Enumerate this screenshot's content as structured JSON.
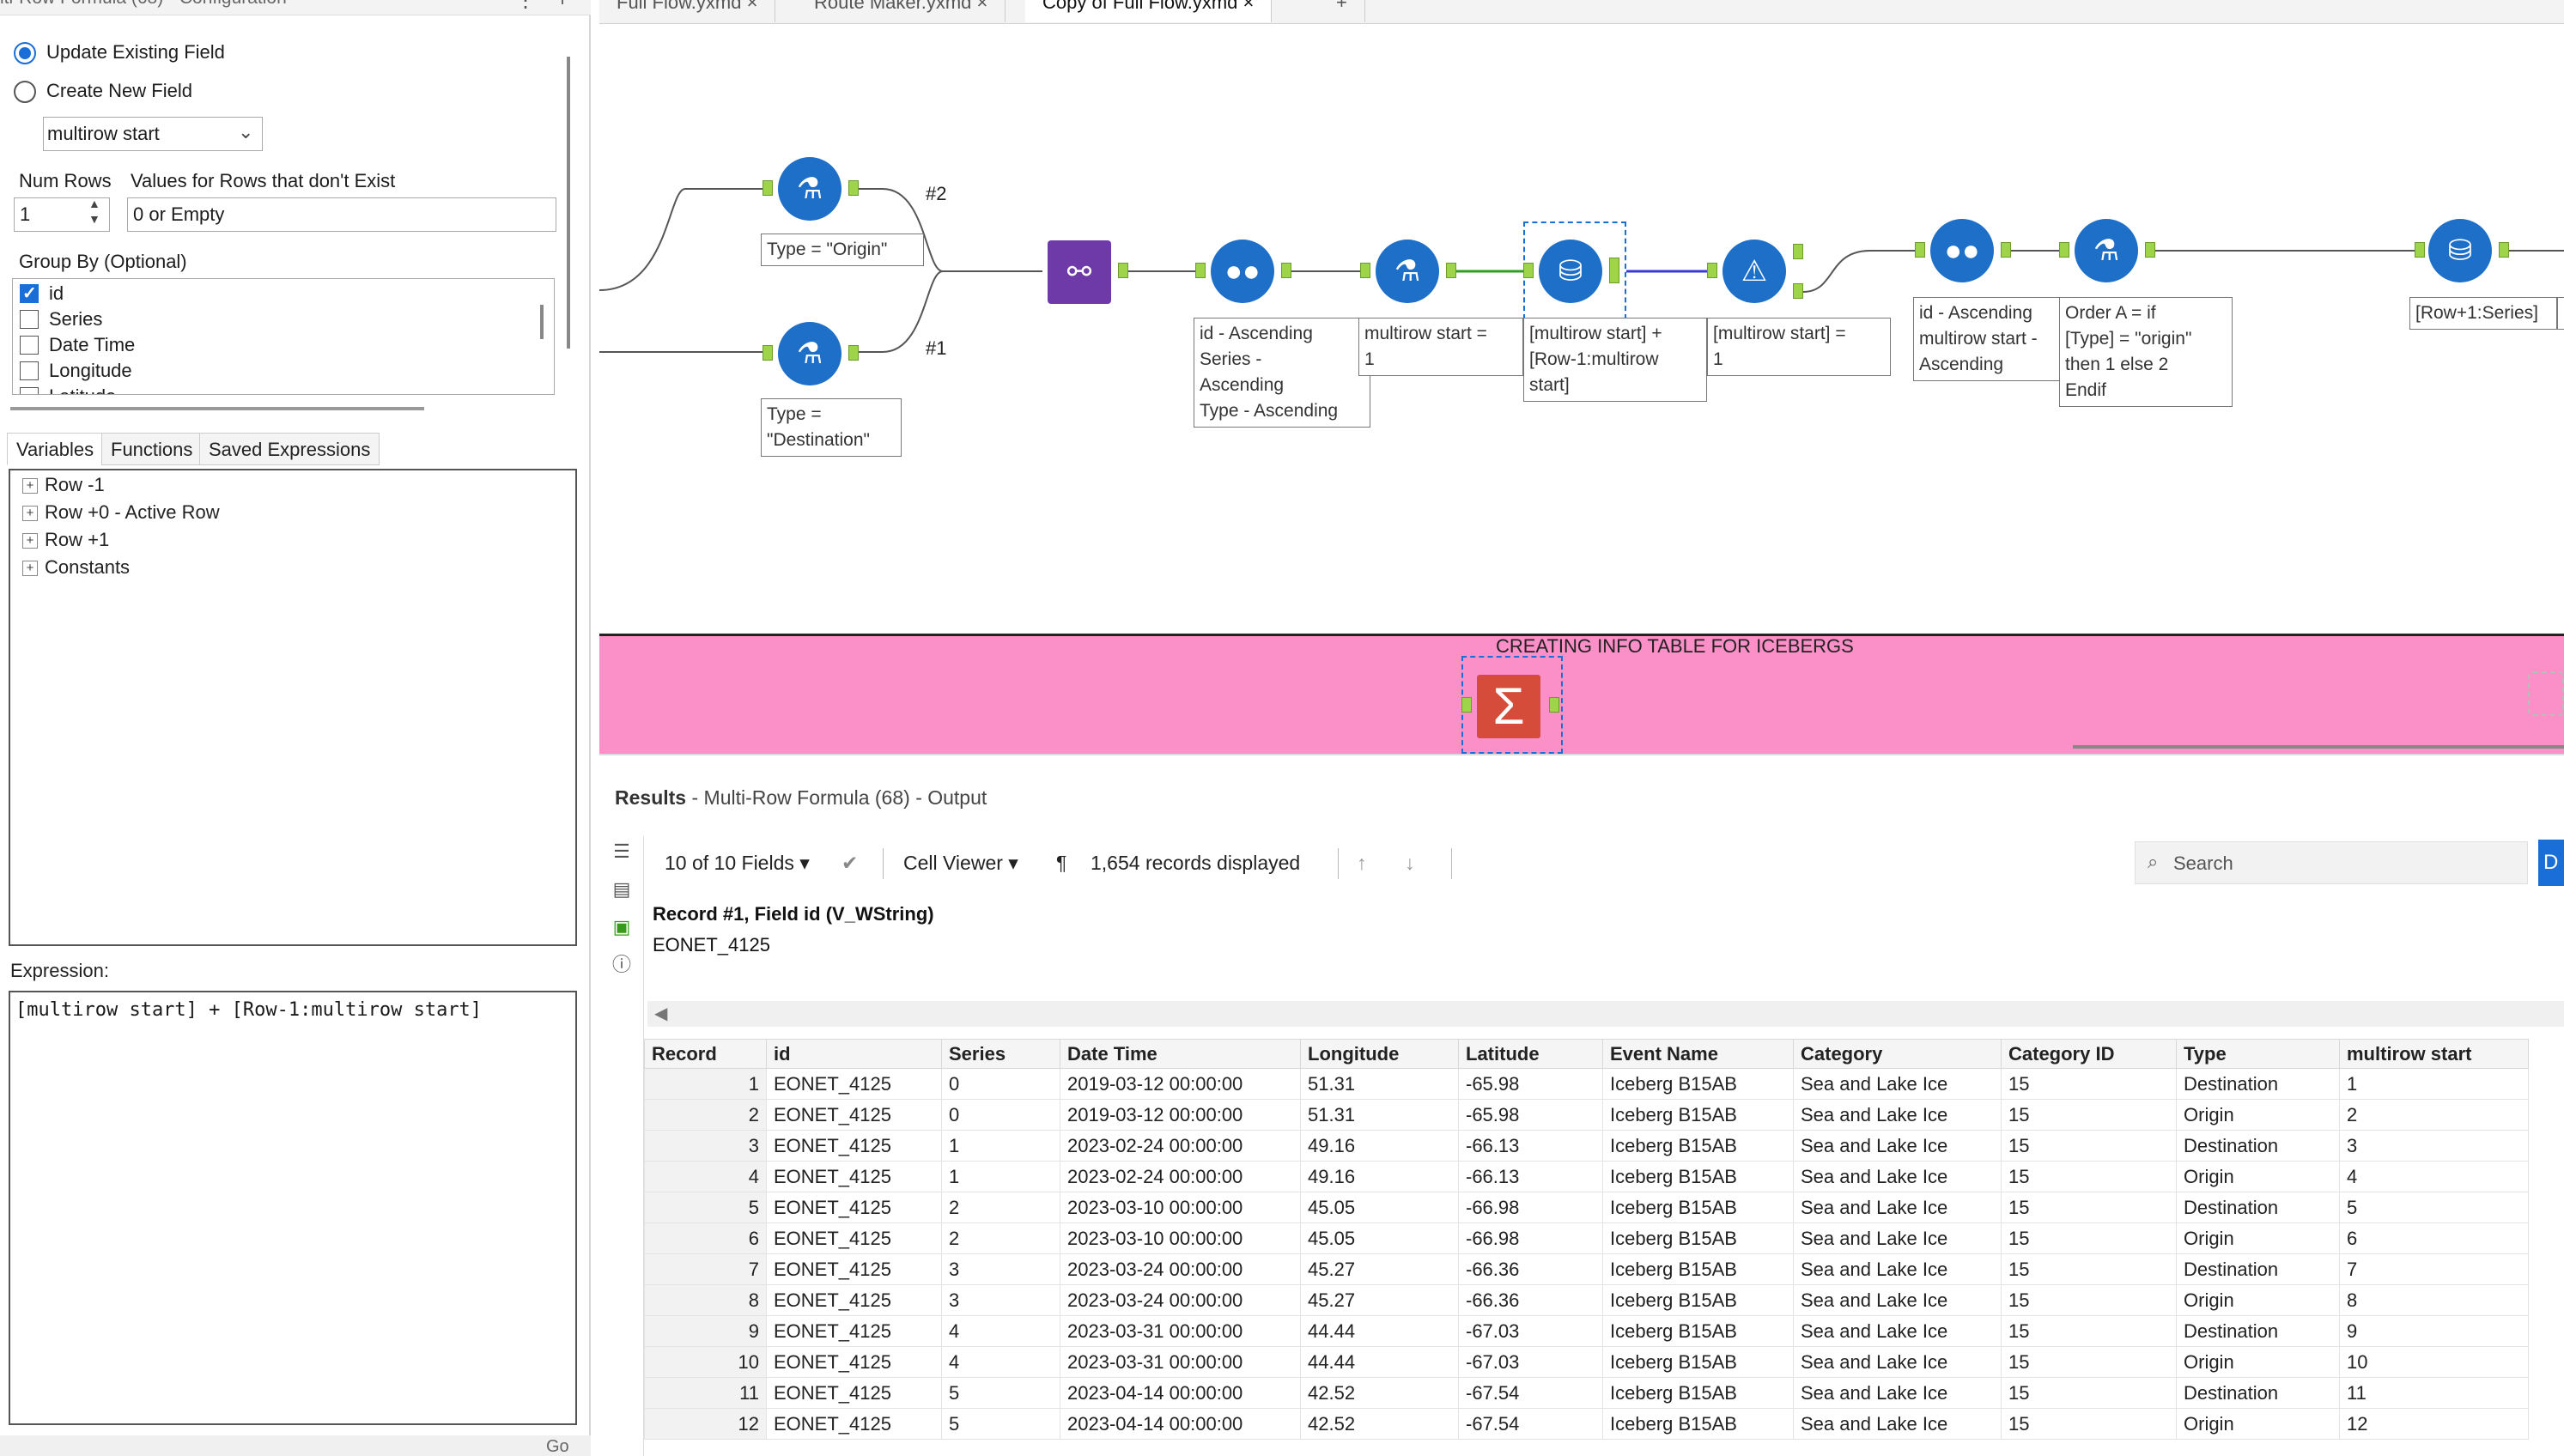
{
  "config": {
    "title": "lti-Row Formula (68) - Configuration",
    "update_existing": "Update Existing Field",
    "create_new": "Create New  Field",
    "field_select": "multirow start",
    "num_rows_label": "Num Rows",
    "num_rows_value": "1",
    "values_label": "Values for Rows that don't Exist",
    "values_value": "0 or Empty",
    "group_by_label": "Group By (Optional)",
    "group_fields": [
      "id",
      "Series",
      "Date Time",
      "Longitude",
      "Latitude"
    ],
    "tabs": [
      "Variables",
      "Functions",
      "Saved Expressions"
    ],
    "tree": [
      "Row -1",
      "Row +0 - Active Row",
      "Row +1",
      "Constants"
    ],
    "expression_label": "Expression:",
    "expression": "[multirow start] + [Row-1:multirow start]",
    "go_label": "Go"
  },
  "canvas": {
    "tabs": [
      "Full Flow.yxmd",
      "Route Maker.yxmd",
      "Copy of Full Flow.yxmd"
    ],
    "anchors": [
      "#2",
      "#1"
    ],
    "annotations": {
      "filter_origin": "Type = \"Origin\"",
      "filter_dest": [
        "Type =",
        "\"Destination\""
      ],
      "sort1": [
        "id - Ascending",
        "Series -",
        "Ascending",
        "Type - Ascending"
      ],
      "formula1": [
        "multirow start =",
        "1"
      ],
      "multirow": [
        "[multirow start] +",
        "[Row-1:multirow",
        "start]"
      ],
      "filter2": [
        "[multirow start] =",
        "1"
      ],
      "sort2": [
        "id - Ascending",
        "multirow start -",
        "Ascending"
      ],
      "formula2": [
        "Order A = if",
        "[Type] = \"origin\"",
        "then 1 else 2",
        "Endif"
      ],
      "multirow2": "[Row+1:Series]"
    },
    "container_title": "CREATING INFO TABLE FOR ICEBERGS"
  },
  "results": {
    "title_bold": "Results",
    "title_rest": " - Multi-Row Formula (68) - Output",
    "fields": "10 of 10 Fields",
    "cell_viewer": "Cell Viewer",
    "records": "1,654 records displayed",
    "search_placeholder": "Search",
    "blue_btn": "D",
    "record_info": "Record #1, Field id (V_WString)",
    "record_value": "EONET_4125",
    "columns": [
      "Record",
      "id",
      "Series",
      "Date Time",
      "Longitude",
      "Latitude",
      "Event Name",
      "Category",
      "Category ID",
      "Type",
      "multirow start"
    ],
    "rows": [
      [
        "1",
        "EONET_4125",
        "0",
        "2019-03-12 00:00:00",
        "51.31",
        "-65.98",
        "Iceberg B15AB",
        "Sea and Lake Ice",
        "15",
        "Destination",
        "1"
      ],
      [
        "2",
        "EONET_4125",
        "0",
        "2019-03-12 00:00:00",
        "51.31",
        "-65.98",
        "Iceberg B15AB",
        "Sea and Lake Ice",
        "15",
        "Origin",
        "2"
      ],
      [
        "3",
        "EONET_4125",
        "1",
        "2023-02-24 00:00:00",
        "49.16",
        "-66.13",
        "Iceberg B15AB",
        "Sea and Lake Ice",
        "15",
        "Destination",
        "3"
      ],
      [
        "4",
        "EONET_4125",
        "1",
        "2023-02-24 00:00:00",
        "49.16",
        "-66.13",
        "Iceberg B15AB",
        "Sea and Lake Ice",
        "15",
        "Origin",
        "4"
      ],
      [
        "5",
        "EONET_4125",
        "2",
        "2023-03-10 00:00:00",
        "45.05",
        "-66.98",
        "Iceberg B15AB",
        "Sea and Lake Ice",
        "15",
        "Destination",
        "5"
      ],
      [
        "6",
        "EONET_4125",
        "2",
        "2023-03-10 00:00:00",
        "45.05",
        "-66.98",
        "Iceberg B15AB",
        "Sea and Lake Ice",
        "15",
        "Origin",
        "6"
      ],
      [
        "7",
        "EONET_4125",
        "3",
        "2023-03-24 00:00:00",
        "45.27",
        "-66.36",
        "Iceberg B15AB",
        "Sea and Lake Ice",
        "15",
        "Destination",
        "7"
      ],
      [
        "8",
        "EONET_4125",
        "3",
        "2023-03-24 00:00:00",
        "45.27",
        "-66.36",
        "Iceberg B15AB",
        "Sea and Lake Ice",
        "15",
        "Origin",
        "8"
      ],
      [
        "9",
        "EONET_4125",
        "4",
        "2023-03-31 00:00:00",
        "44.44",
        "-67.03",
        "Iceberg B15AB",
        "Sea and Lake Ice",
        "15",
        "Destination",
        "9"
      ],
      [
        "10",
        "EONET_4125",
        "4",
        "2023-03-31 00:00:00",
        "44.44",
        "-67.03",
        "Iceberg B15AB",
        "Sea and Lake Ice",
        "15",
        "Origin",
        "10"
      ],
      [
        "11",
        "EONET_4125",
        "5",
        "2023-04-14 00:00:00",
        "42.52",
        "-67.54",
        "Iceberg B15AB",
        "Sea and Lake Ice",
        "15",
        "Destination",
        "11"
      ],
      [
        "12",
        "EONET_4125",
        "5",
        "2023-04-14 00:00:00",
        "42.52",
        "-67.54",
        "Iceberg B15AB",
        "Sea and Lake Ice",
        "15",
        "Origin",
        "12"
      ]
    ]
  },
  "colors": {
    "tool_blue": "#1e6fc8",
    "container_pink": "#fb8fc7",
    "port_green": "#9dd44a",
    "accent_blue": "#1a6ed8"
  }
}
